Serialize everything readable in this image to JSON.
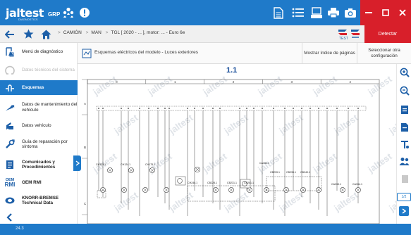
{
  "app": {
    "brand_logo": "jaltest",
    "brand_sub": "DIAGNOSTICS",
    "brand_grp": "GRP",
    "version": "24.3",
    "accent_color": "#1f7ac9",
    "alert_color": "#d81f2a"
  },
  "topbar": {
    "icons": [
      "people-icon",
      "alert-icon",
      "document-icon",
      "list-icon",
      "monitor-icon",
      "printer-icon",
      "camera-icon",
      "help-icon",
      "grid-icon"
    ],
    "help_glyph": "?"
  },
  "navbar": {
    "breadcrumb": [
      "CAMIÓN",
      "MAN",
      "TGL [ 2020 - ... ], motor: ... - Euro 6e"
    ],
    "detect_label": "Detectar"
  },
  "sidebar": {
    "items": [
      {
        "label": "Menú de diagnóstico",
        "icon": "diagnostic-menu-icon"
      },
      {
        "label": "Datos técnicos del sistema",
        "icon": "technical-data-icon"
      },
      {
        "label": "Esquemas",
        "icon": "schematics-icon"
      },
      {
        "label": "Datos de mantenimiento del vehículo",
        "icon": "maintenance-icon"
      },
      {
        "label": "Datos vehículo",
        "icon": "vehicle-data-icon"
      },
      {
        "label": "Guía de reparación por síntoma",
        "icon": "repair-guide-icon"
      },
      {
        "label": "Comunicados y Procedimientos",
        "icon": "procedures-icon"
      },
      {
        "label": "OEM RMI",
        "icon": "oem-rmi-icon"
      },
      {
        "label": "KNORR-BREMSE Technical Data",
        "icon": "knorr-bremse-icon"
      }
    ],
    "oem_badge_top": "OEM",
    "oem_badge_bottom": "RMI"
  },
  "document": {
    "title": "Esquemas eléctricos del modelo - Luces exteriores",
    "btn_index": "Mostrar índice de páginas",
    "btn_config": "Seleccionar otra configuración",
    "sheet_number": "1.1",
    "watermark": "jaltest",
    "page_indicator": "1/2",
    "grid_columns": [
      "0",
      "1",
      "2",
      "3",
      "4"
    ],
    "grid_rows": [
      "A",
      "B",
      "C"
    ],
    "connector_labels": [
      "CH125.1",
      "CH124.1",
      "CH175.1",
      "CA332.1",
      "CB239.1",
      "CB235.1",
      "CB240.1",
      "CH246.1",
      "CB228.1",
      "CB231.1",
      "CB241.1",
      "CA333.1",
      "CA334.1"
    ],
    "box_labels": [
      "CH246.1PT",
      "CB228.1",
      "CB231.1",
      "CB241.1",
      "CH246.1PT",
      "CB239.1",
      "CB235.1",
      "CB240.1"
    ]
  },
  "rail": {
    "icons": [
      "zoom-in-icon",
      "zoom-out-icon",
      "component-list-icon",
      "document-export-icon",
      "location-icon",
      "users-icon",
      "layers-icon"
    ]
  }
}
